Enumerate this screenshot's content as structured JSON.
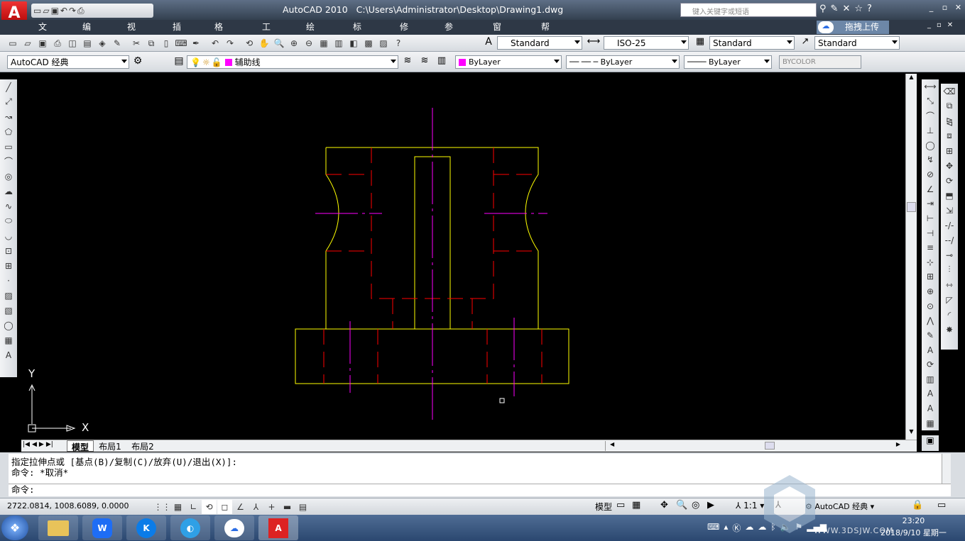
{
  "window": {
    "app_name": "AutoCAD 2010",
    "file_path": "C:\\Users\\Administrator\\Desktop\\Drawing1.dwg",
    "search_placeholder": "键入关键字或短语"
  },
  "menu": [
    "文件(F)",
    "编辑(E)",
    "视图(V)",
    "插入(I)",
    "格式(O)",
    "工具(T)",
    "绘图(D)",
    "标注(N)",
    "修改(M)",
    "参数(P)",
    "窗口(W)",
    "帮助(H)"
  ],
  "upload_label": "拖拽上传",
  "styles": {
    "text_style": "Standard",
    "dim_style": "ISO-25",
    "table_style": "Standard",
    "mleader_style": "Standard"
  },
  "workspace": "AutoCAD 经典",
  "layer": {
    "name": "辅助线",
    "color": "#ff00ff"
  },
  "props": {
    "color": "ByLayer",
    "linetype": "ByLayer",
    "lineweight": "ByLayer",
    "plotstyle": "BYCOLOR"
  },
  "ucs": {
    "x_label": "X",
    "y_label": "Y"
  },
  "tabs": [
    "模型",
    "布局1",
    "布局2"
  ],
  "command": {
    "line1": "指定拉伸点或 [基点(B)/复制(C)/放弃(U)/退出(X)]:",
    "line2": "命令: *取消*",
    "prompt": "命令:"
  },
  "status": {
    "coords": "2722.0814, 1008.6089, 0.0000",
    "model_label": "模型",
    "scale": "1:1",
    "workspace": "AutoCAD 经典"
  },
  "clock": {
    "time": "23:20",
    "date": "2018/9/10 星期一"
  },
  "watermark": "WWW.3DSJW.COM",
  "colors": {
    "yellow": "#ffff00",
    "red": "#ff0000",
    "magenta": "#ff00ff"
  }
}
